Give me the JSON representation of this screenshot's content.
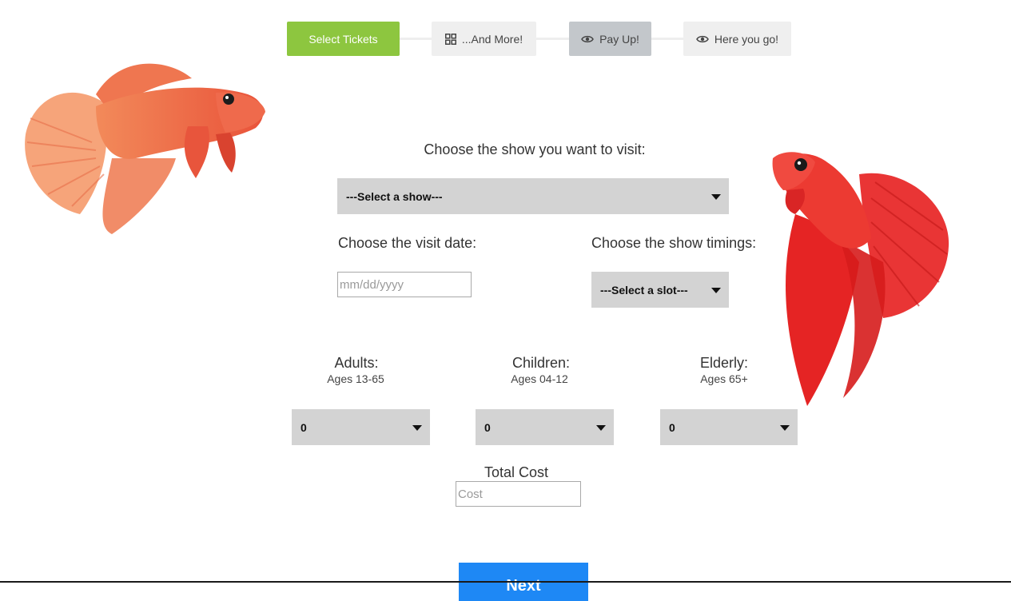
{
  "steps": [
    {
      "label": "Select Tickets",
      "icon": "none",
      "state": "active"
    },
    {
      "label": "...And More!",
      "icon": "grid-icon",
      "state": "inactive"
    },
    {
      "label": "Pay Up!",
      "icon": "eye-icon",
      "state": "current"
    },
    {
      "label": "Here you go!",
      "icon": "eye-icon",
      "state": "inactive"
    }
  ],
  "show": {
    "label": "Choose the show you want to visit:",
    "selected": "---Select a show---"
  },
  "date": {
    "label": "Choose the visit date:",
    "placeholder": "mm/dd/yyyy"
  },
  "timing": {
    "label": "Choose the show timings:",
    "selected": "---Select a slot---"
  },
  "tickets": {
    "adults": {
      "label": "Adults:",
      "ages": "Ages 13-65",
      "selected": "0"
    },
    "children": {
      "label": "Children:",
      "ages": "Ages 04-12",
      "selected": "0"
    },
    "elderly": {
      "label": "Elderly:",
      "ages": "Ages 65+",
      "selected": "0"
    }
  },
  "total": {
    "label": "Total Cost",
    "placeholder": "Cost"
  },
  "next_label": "Next",
  "colors": {
    "active_step": "#8dc63f",
    "current_step": "#c3c7cb",
    "select_bg": "#d3d3d3",
    "next_button": "#1e88f5"
  }
}
